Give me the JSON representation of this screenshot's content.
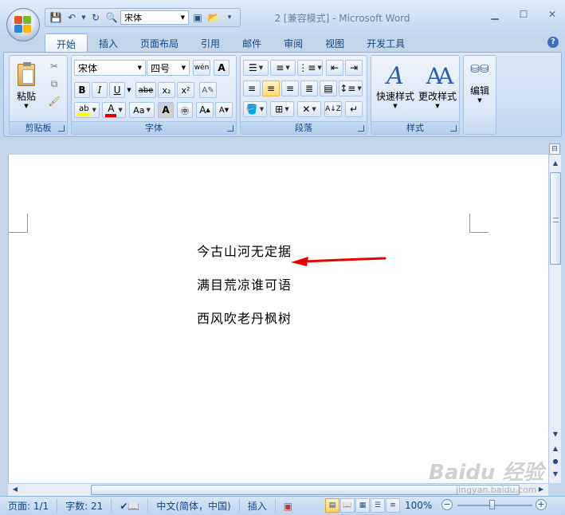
{
  "window": {
    "title": "2 [兼容模式] - Microsoft Word"
  },
  "qat": {
    "font_box": "宋体"
  },
  "tabs": [
    "开始",
    "插入",
    "页面布局",
    "引用",
    "邮件",
    "审阅",
    "视图",
    "开发工具"
  ],
  "ribbon": {
    "clipboard": {
      "label": "剪贴板",
      "paste": "粘贴"
    },
    "font": {
      "label": "字体",
      "font_name": "宋体",
      "font_size": "四号",
      "bold": "B",
      "italic": "I",
      "underline": "U",
      "strike": "abe",
      "subscript": "x₂",
      "superscript": "x²",
      "aa": "Aa",
      "grow": "A",
      "shrink": "A"
    },
    "paragraph": {
      "label": "段落"
    },
    "styles": {
      "label": "样式",
      "quick_styles": "快速样式",
      "change_styles": "更改样式"
    },
    "editing": {
      "label": "编辑"
    }
  },
  "document": {
    "lines": [
      "今古山河无定据",
      "满目荒凉谁可语",
      "西风吹老丹枫树"
    ]
  },
  "status": {
    "page": "页面: 1/1",
    "words": "字数: 21",
    "language": "中文(简体，中国)",
    "mode": "插入",
    "zoom": "100%"
  },
  "watermark": {
    "main": "Baidu 经验",
    "sub": "jingyan.baidu.com"
  },
  "colors": {
    "accent": "#15428b",
    "highlight": "#ffd97a",
    "arrow": "#e60000"
  }
}
